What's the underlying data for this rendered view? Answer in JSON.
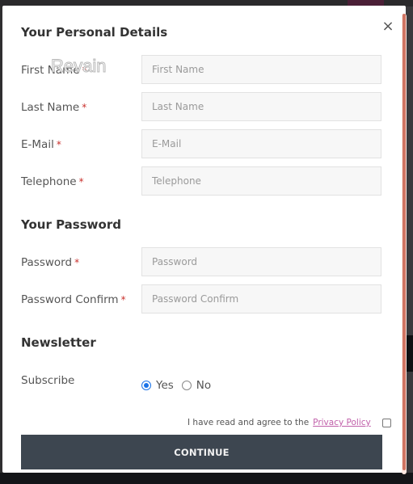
{
  "modal": {
    "close_icon": "×",
    "watermark": "Revain",
    "sections": {
      "personal": "Your Personal Details",
      "password": "Your Password",
      "newsletter": "Newsletter"
    },
    "fields": {
      "first_name": {
        "label": "First Name",
        "required": "*",
        "placeholder": "First Name",
        "value": ""
      },
      "last_name": {
        "label": "Last Name",
        "required": "*",
        "placeholder": "Last Name",
        "value": ""
      },
      "email": {
        "label": "E-Mail",
        "required": "*",
        "placeholder": "E-Mail",
        "value": ""
      },
      "telephone": {
        "label": "Telephone",
        "required": "*",
        "placeholder": "Telephone",
        "value": ""
      },
      "password": {
        "label": "Password",
        "required": "*",
        "placeholder": "Password",
        "value": ""
      },
      "password_confirm": {
        "label": "Password Confirm",
        "required": "*",
        "placeholder": "Password Confirm",
        "value": ""
      }
    },
    "subscribe": {
      "label": "Subscribe",
      "options": [
        {
          "label": "Yes",
          "checked": true
        },
        {
          "label": "No",
          "checked": false
        }
      ]
    },
    "agree": {
      "text": "I have read and agree to the",
      "link": "Privacy Policy",
      "checked": false
    },
    "continue_label": "CONTINUE"
  },
  "colors": {
    "button_bg": "#3d4650",
    "scrollbar": "#d07563",
    "radio_accent": "#1a73e8",
    "link": "#c05fa9",
    "required": "#c9302c"
  }
}
